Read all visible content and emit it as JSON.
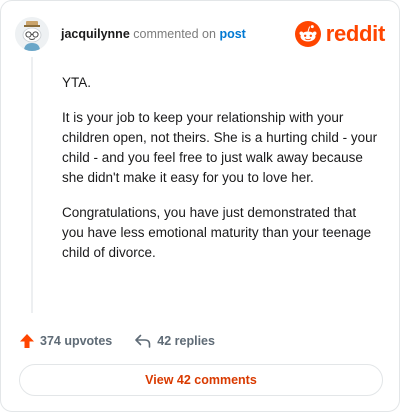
{
  "header": {
    "username": "jacquilynne",
    "action_text": "commented on",
    "post_link": "post",
    "brand": "reddit",
    "avatar_icon": "snoo-avatar-icon",
    "brand_color": "#ff4500"
  },
  "comment": {
    "paragraphs": [
      "YTA.",
      "It is your job to keep your relationship with your children open, not theirs. She is a hurting child - your child - and you feel free to just walk away because she didn't make it easy for you to love her.",
      "Congratulations, you have just demonstrated that you have less emotional maturity than your teenage child of divorce."
    ]
  },
  "actions": {
    "upvotes": "374 upvotes",
    "replies": "42 replies",
    "upvote_icon": "upvote-arrow-icon",
    "reply_icon": "reply-arrow-icon",
    "upvote_color": "#ff4500"
  },
  "footer": {
    "view_comments": "View 42 comments"
  }
}
